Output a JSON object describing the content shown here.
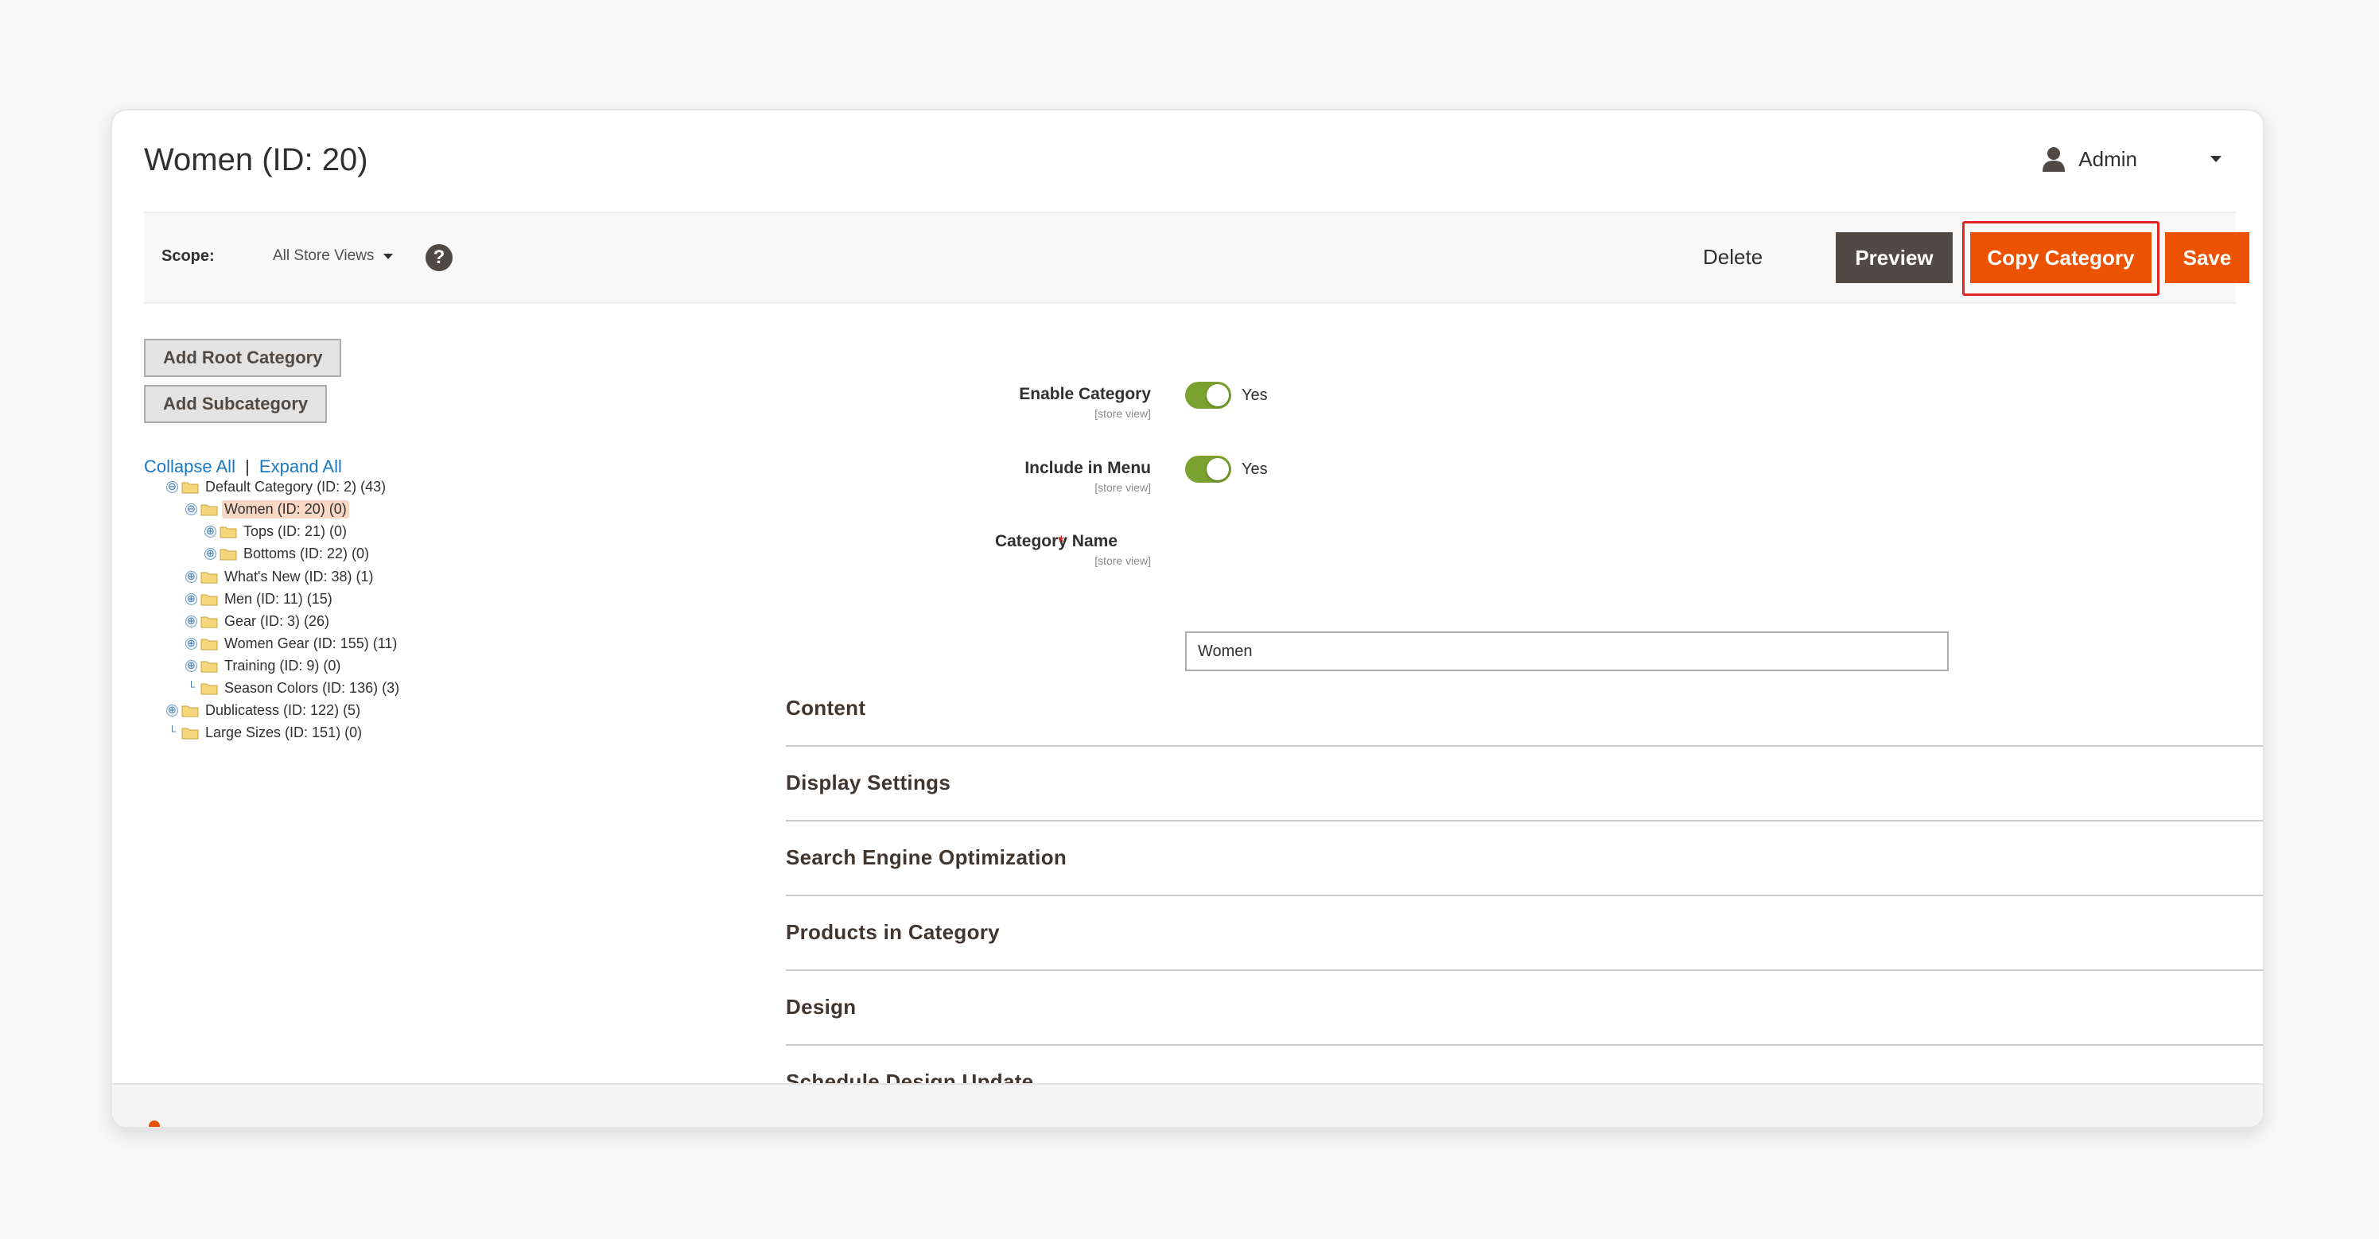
{
  "page": {
    "title": "Women (ID: 20)"
  },
  "admin": {
    "label": "Admin"
  },
  "actions": {
    "scope_label": "Scope:",
    "scope_value": "All Store Views",
    "help": "?",
    "delete": "Delete",
    "preview": "Preview",
    "copy": "Copy Category",
    "save": "Save"
  },
  "tree": {
    "add_root": "Add Root Category",
    "add_sub": "Add Subcategory",
    "collapse": "Collapse All",
    "separator": "|",
    "expand": "Expand All",
    "nodes": [
      "Default Category (ID: 2) (43)",
      "Women (ID: 20) (0)",
      "Tops (ID: 21) (0)",
      "Bottoms (ID: 22) (0)",
      "What's New (ID: 38) (1)",
      "Men (ID: 11) (15)",
      "Gear (ID: 3) (26)",
      "Women Gear (ID: 155) (11)",
      "Training (ID: 9) (0)",
      "Season Colors (ID: 136) (3)",
      "Dublicatess (ID: 122) (5)",
      "Large Sizes (ID: 151) (0)"
    ]
  },
  "form": {
    "enable": {
      "label": "Enable Category",
      "scope": "[store view]",
      "value": "Yes"
    },
    "menu": {
      "label": "Include in Menu",
      "scope": "[store view]",
      "value": "Yes"
    },
    "name": {
      "label": "Category Name",
      "scope": "[store view]",
      "required": "*",
      "value": "Women"
    }
  },
  "sections": [
    "Content",
    "Display Settings",
    "Search Engine Optimization",
    "Products in Category",
    "Design",
    "Schedule Design Update"
  ],
  "colors": {
    "accent": "#eb5202",
    "dark_button": "#514943",
    "toggle_on": "#79a22e",
    "link": "#1979c3",
    "highlight_border": "#e22626"
  }
}
